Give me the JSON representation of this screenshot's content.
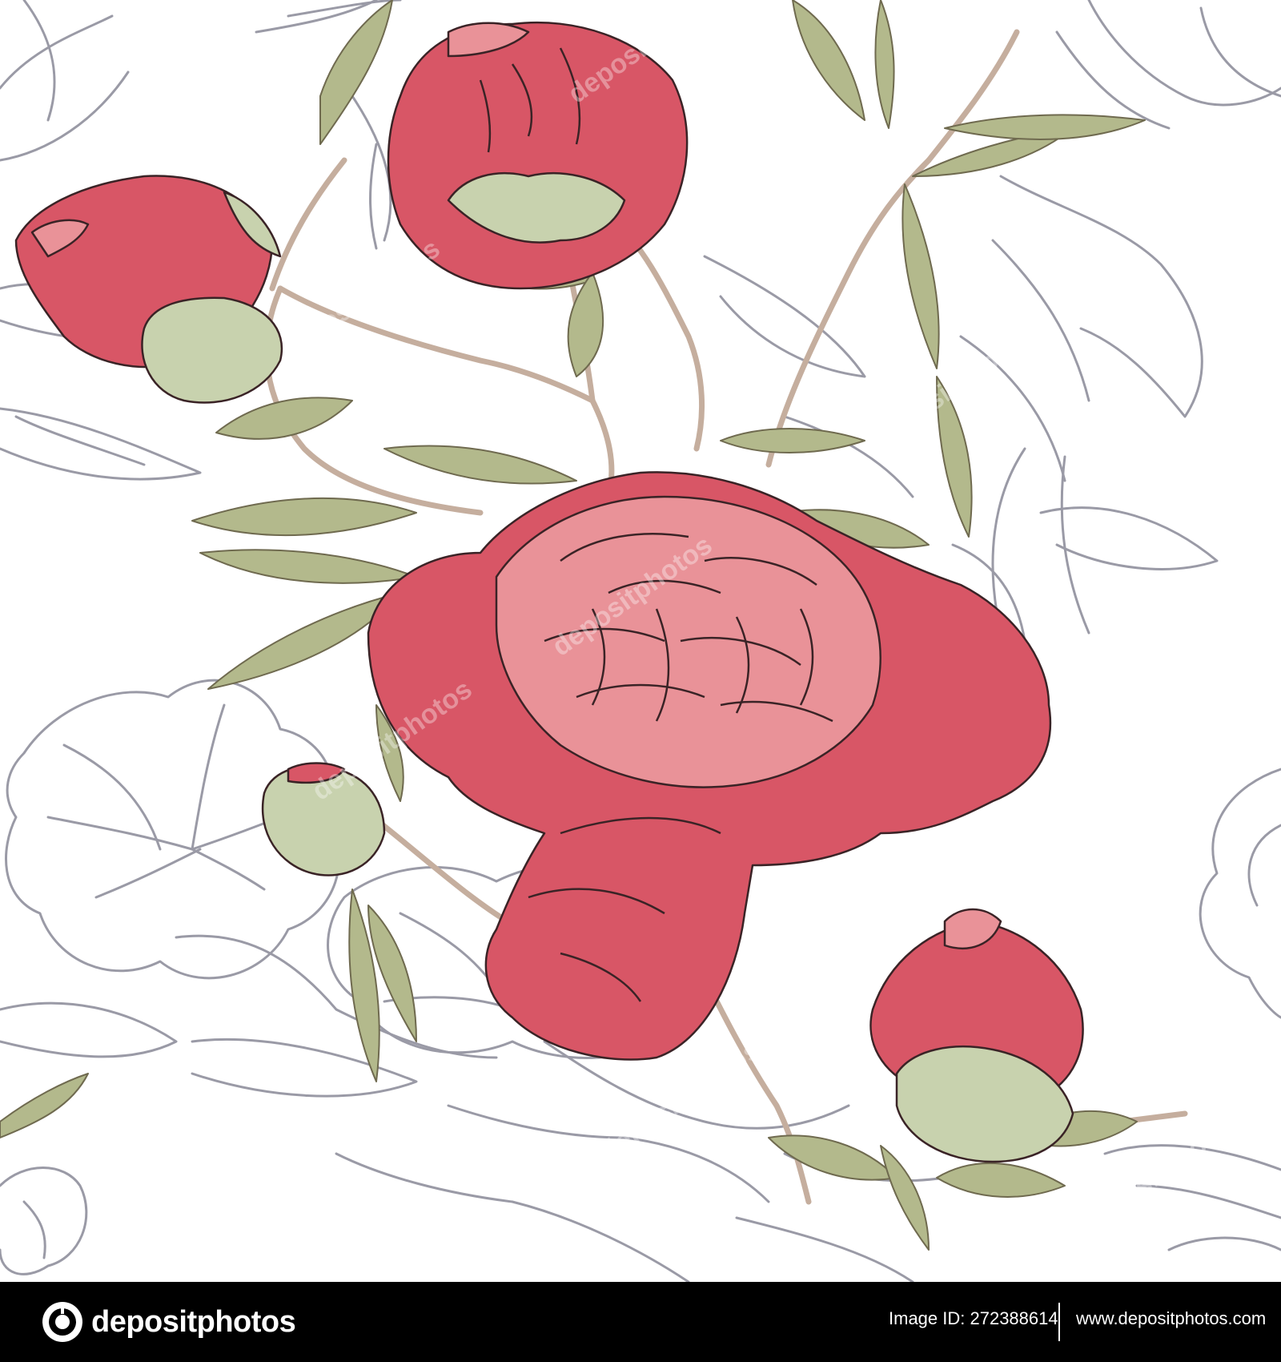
{
  "artwork": {
    "subject": "seamless pattern with red peonies, buds and leaves over grey outline flowers",
    "watermark_text": "depositphotos",
    "colors": {
      "background": "#ffffff",
      "petal_red": "#d85666",
      "petal_pink": "#e99298",
      "leaf_green": "#b3b98c",
      "bud_green": "#c8d2ae",
      "stem": "#c5ae9e",
      "outline_grey": "#9a9aa6",
      "ink": "#3a2326"
    }
  },
  "footer": {
    "brand": "depositphotos",
    "image_id": "Image ID: 272388614",
    "site": "www.depositphotos.com",
    "icon": "depositphotos-logo-icon"
  }
}
